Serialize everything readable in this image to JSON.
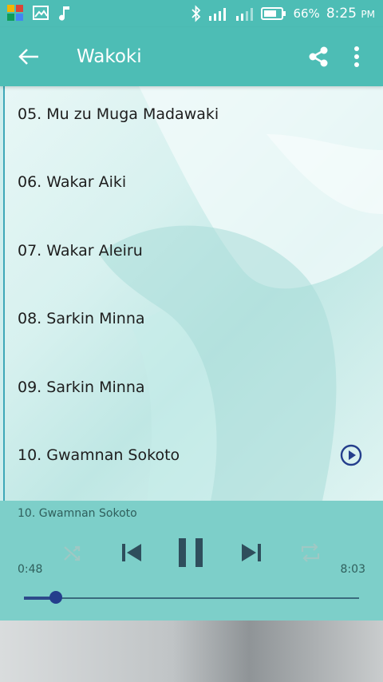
{
  "status_bar": {
    "battery": "66%",
    "time": "8:25",
    "ampm": "PM"
  },
  "app_bar": {
    "title": "Wakoki"
  },
  "tracks": [
    {
      "label": "05. Mu zu Muga Madawaki"
    },
    {
      "label": "06. Wakar Aiki"
    },
    {
      "label": "07. Wakar Aleiru"
    },
    {
      "label": "08. Sarkin Minna"
    },
    {
      "label": "09. Sarkin Minna"
    },
    {
      "label": "10. Gwamnan Sokoto"
    }
  ],
  "player": {
    "now_playing": "10. Gwamnan Sokoto",
    "elapsed": "0:48",
    "duration": "8:03",
    "progress": 0.095
  },
  "colors": {
    "accent": "#4dbdb5",
    "player_bg": "#7dcfc9",
    "play_icon": "#243e8c"
  }
}
